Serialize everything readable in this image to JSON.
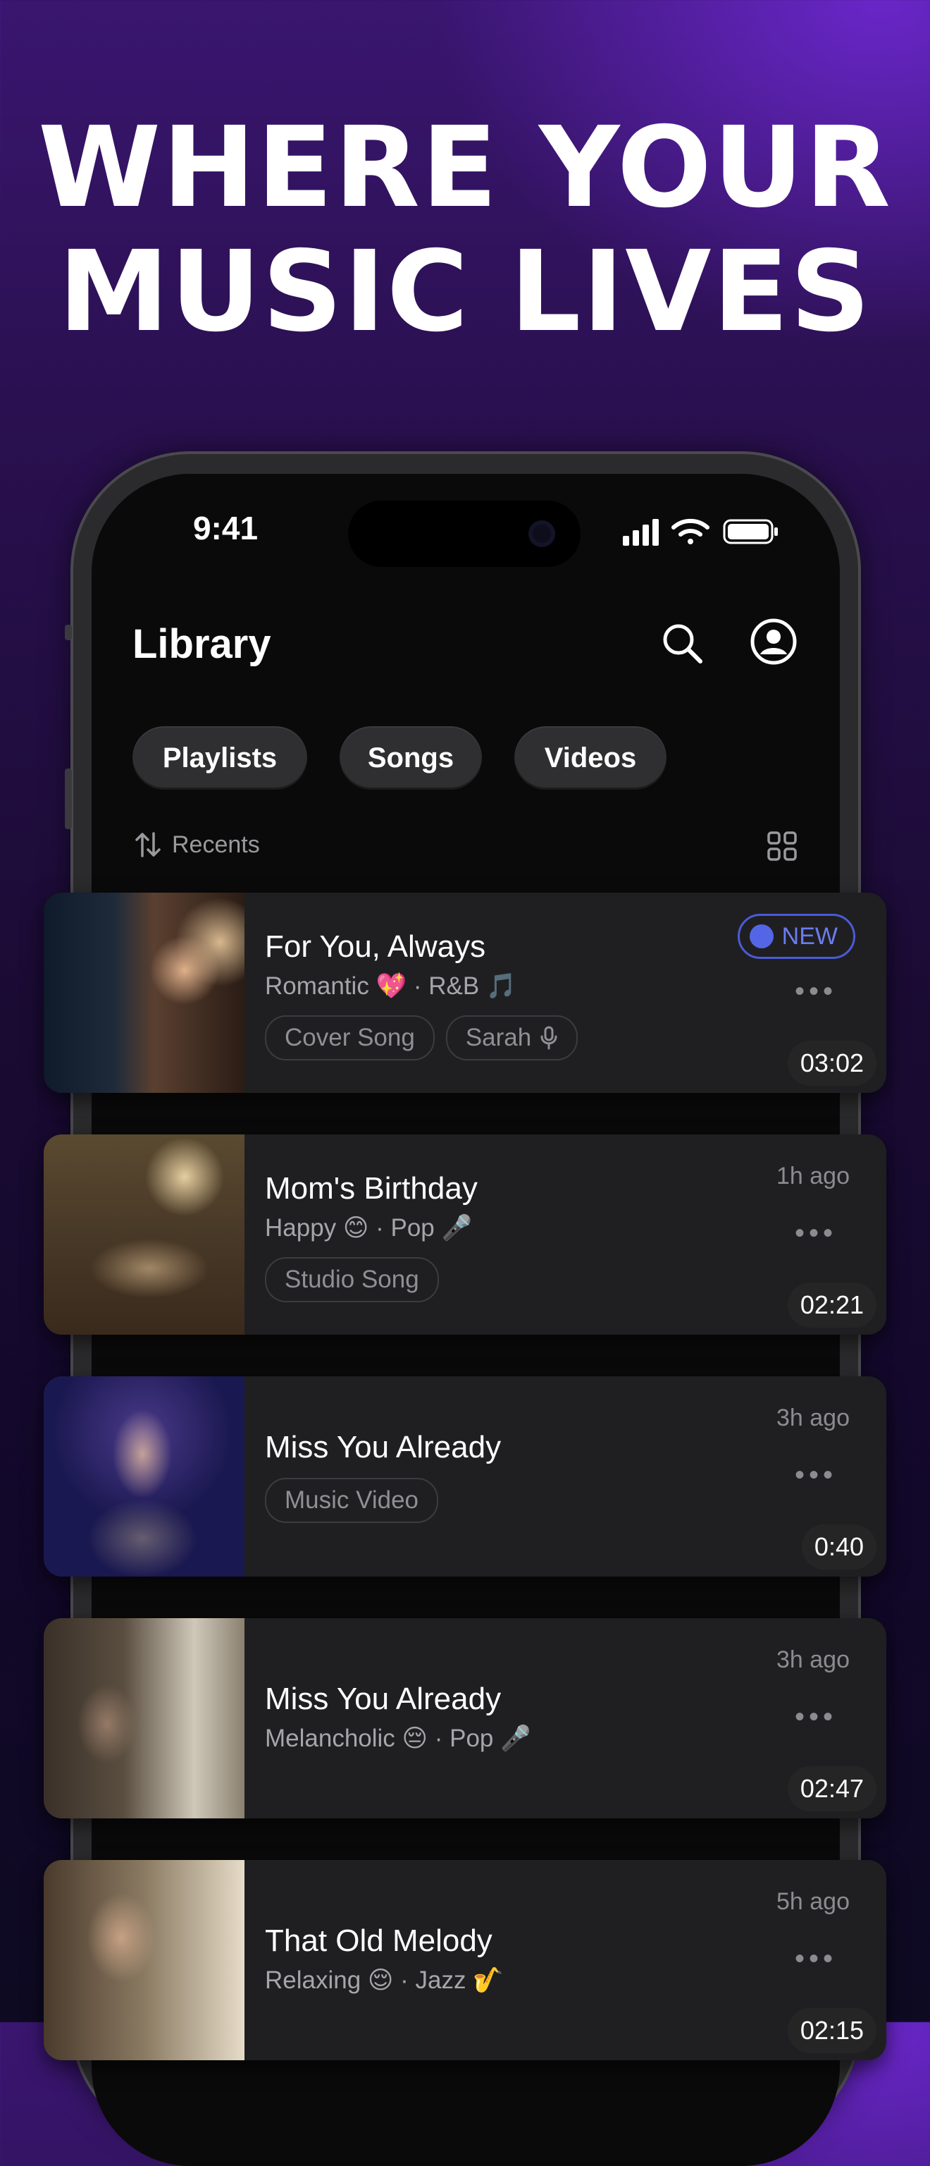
{
  "headline": {
    "line1": "WHERE YOUR",
    "line2": "MUSIC LIVES"
  },
  "status_bar": {
    "time": "9:41"
  },
  "header": {
    "title": "Library"
  },
  "filters": [
    {
      "label": "Playlists"
    },
    {
      "label": "Songs"
    },
    {
      "label": "Videos"
    }
  ],
  "sort": {
    "label": "Recents"
  },
  "items": [
    {
      "title": "For You, Always",
      "meta": "Romantic 💖 · R&B 🎵",
      "duration": "03:02",
      "badge": "NEW",
      "tags": [
        "Cover Song",
        "Sarah"
      ]
    },
    {
      "title": "Mom's Birthday",
      "meta": "Happy 😊 · Pop 🎤",
      "duration": "02:21",
      "time": "1h ago",
      "tags": [
        "Studio Song"
      ]
    },
    {
      "title": "Miss You Already",
      "duration": "0:40",
      "time": "3h ago",
      "tags": [
        "Music Video"
      ]
    },
    {
      "title": "Miss You Already",
      "meta": "Melancholic 😔 · Pop 🎤",
      "duration": "02:47",
      "time": "3h ago"
    },
    {
      "title": "That Old Melody",
      "meta": "Relaxing 😌 · Jazz 🎷",
      "duration": "02:15",
      "time": "5h ago"
    }
  ],
  "more_label": "•••",
  "colors": {
    "accent": "#5466e6",
    "card_bg": "#1f1f21",
    "background_top": "#4b1a8f"
  }
}
